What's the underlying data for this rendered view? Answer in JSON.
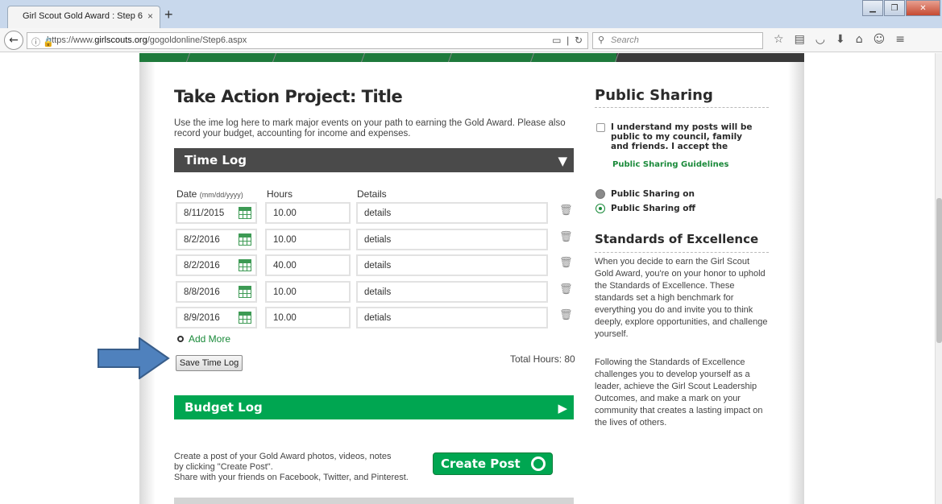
{
  "browser": {
    "tab_title": "Girl Scout Gold Award : Step 6",
    "tab_close": "×",
    "new_tab": "+",
    "url_prefix": "https://www.",
    "url_host": "girlscouts.org",
    "url_path": "/gogoldonline/Step6.aspx",
    "search_placeholder": "Search"
  },
  "page": {
    "title": "Take Action Project: Title",
    "intro": "Use the ime log here to mark major events on your path to earning the Gold Award. Please also record your budget, accounting for income and expenses.",
    "time_log_label": "Time Log",
    "columns": {
      "date": "Date",
      "date_hint": "(mm/dd/yyyy)",
      "hours": "Hours",
      "details": "Details"
    },
    "rows": [
      {
        "date": "8/11/2015",
        "hours": "10.00",
        "details": "details"
      },
      {
        "date": "8/2/2016",
        "hours": "10.00",
        "details": "detials"
      },
      {
        "date": "8/2/2016",
        "hours": "40.00",
        "details": "details"
      },
      {
        "date": "8/8/2016",
        "hours": "10.00",
        "details": "details"
      },
      {
        "date": "8/9/2016",
        "hours": "10.00",
        "details": "detials"
      }
    ],
    "add_more": "Add More",
    "save_time_log": "Save Time Log",
    "total_hours": "Total Hours: 80",
    "budget_log_label": "Budget Log",
    "post_lines": [
      "Create a post of your Gold Award photos, videos, notes",
      "by clicking \"Create Post\".",
      "Share with your friends on Facebook, Twitter, and Pinterest."
    ],
    "create_post": "Create Post"
  },
  "sidebar": {
    "public_sharing_title": "Public Sharing",
    "agree_text": "I understand my posts will be public to my council, family and friends. I accept the",
    "guidelines_link": "Public Sharing Guidelines",
    "guidelines_suffix": ".",
    "sharing_on": "Public Sharing on",
    "sharing_off": "Public Sharing off",
    "standards_title": "Standards of Excellence",
    "standards_p1": "When you decide to earn the Girl Scout Gold Award, you're on your honor to uphold the Standards of Excellence. These standards set a high benchmark for everything you do and invite you to think deeply, explore opportunities, and challenge yourself.",
    "standards_p2": "Following the Standards of Excellence challenges you to develop yourself as a leader, achieve the Girl Scout Leadership Outcomes, and make a mark on your community that creates a lasting impact on the lives of others."
  },
  "colors": {
    "brand_green": "#00a651",
    "dark_bar": "#4a4a4a",
    "annotation_arrow": "#4f81bd"
  },
  "icons": [
    "back-arrow-icon",
    "info-icon",
    "lock-icon",
    "reader-icon",
    "reload-icon",
    "search-icon",
    "bookmark-star-icon",
    "library-icon",
    "pocket-icon",
    "download-icon",
    "home-icon",
    "chat-icon",
    "menu-icon",
    "calendar-icon",
    "trash-icon",
    "caret-down-icon",
    "caret-right-icon",
    "plus-circle-icon"
  ]
}
